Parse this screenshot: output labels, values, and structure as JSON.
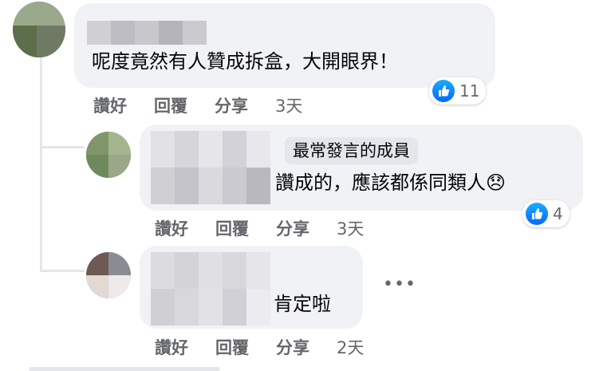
{
  "comments": [
    {
      "text": "呢度竟然有人贊成拆盒，大開眼界！",
      "like_label": "讚好",
      "reply_label": "回覆",
      "share_label": "分享",
      "time": "3天",
      "reaction_count": "11"
    },
    {
      "badge": "最常發言的成員",
      "text": "讚成的，應該都係同類人",
      "emoji": "😞",
      "like_label": "讚好",
      "reply_label": "回覆",
      "share_label": "分享",
      "time": "3天",
      "reaction_count": "4"
    },
    {
      "text": "肯定啦",
      "like_label": "讚好",
      "reply_label": "回覆",
      "share_label": "分享",
      "time": "2天"
    }
  ],
  "icons": {
    "reaction": "thumbs-up-icon",
    "more": "more-options-icon"
  },
  "colors": {
    "like_blue": "#0866ff",
    "bubble": "#f0f2f5",
    "muted": "#65676b"
  }
}
